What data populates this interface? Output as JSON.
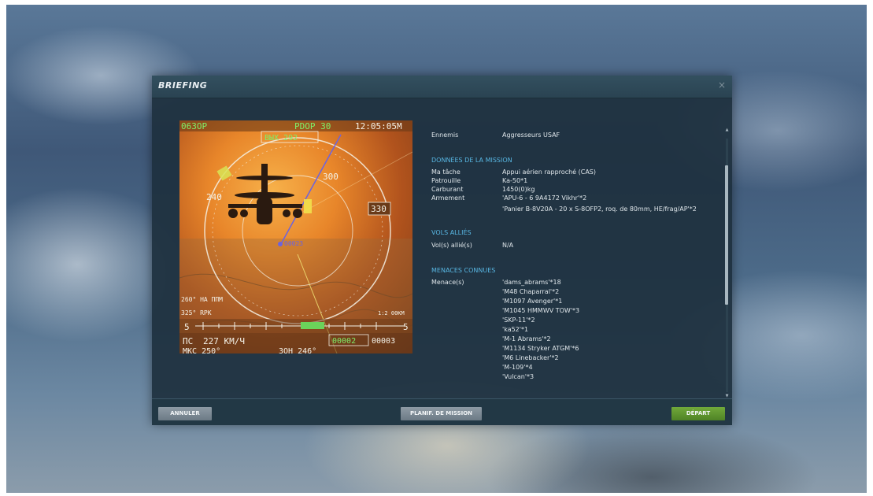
{
  "window": {
    "title": "BRIEFING",
    "close_glyph": "×"
  },
  "hud": {
    "top_left": "063OP",
    "top_mid": "PDOP 30",
    "time": "12:05:05M",
    "heading_box": "ВЫХ 292",
    "speed_label": "ПС",
    "speed_value": "227 КМ/Ч",
    "mag": "МКС 250°",
    "bottom_mid": "ЗОН 246°",
    "alt_box": "00002",
    "alt_right": "00003",
    "bearing_left": "260° НА ППМ",
    "range_left": "325° RPK",
    "right_tag": "330",
    "left_tag": "240",
    "low_tag": "300",
    "scale_text": "1:2 00КМ",
    "marker_tag": "00023"
  },
  "briefing": {
    "partial_row": {
      "key": "Ennemis",
      "value": "Aggresseurs USAF"
    },
    "mission_section": "DONNÉES DE LA MISSION",
    "mission_rows": [
      {
        "key": "Ma tâche",
        "value": "Appui aérien rapproché (CAS)"
      },
      {
        "key": "Patrouille",
        "value": "Ka-50*1"
      },
      {
        "key": "Carburant",
        "value": "1450(0)kg"
      },
      {
        "key": "Armement",
        "value": "'APU-6 - 6 9A4172 Vikhr'*2"
      }
    ],
    "armament_extra": "'Panier B-8V20A - 20 x S-8OFP2, roq. de 80mm, HE/frag/AP'*2",
    "allied_section": "VOLS ALLIÉS",
    "allied_row": {
      "key": "Vol(s) allié(s)",
      "value": "N/A"
    },
    "threats_section": "MENACES CONNUES",
    "threats_key": "Menace(s)",
    "threats": [
      "'dams_abrams'*18",
      "'M48 Chaparral'*2",
      "'M1097 Avenger'*1",
      "'M1045 HMMWV TOW'*3",
      "'SKP-11'*2",
      "'ka52'*1",
      "'M-1 Abrams'*2",
      "'M1134 Stryker ATGM'*6",
      "'M6 Linebacker'*2",
      "'M-109'*4",
      "'Vulcan'*3"
    ]
  },
  "footer": {
    "cancel": "ANNULER",
    "plan": "PLANIF. DE MISSION",
    "depart": "DÉPART"
  },
  "colors": {
    "section_title": "#58b7e3",
    "depart_button": "#5f9830",
    "gray_button": "#7c8a94",
    "hud_green": "#7ef06a"
  }
}
